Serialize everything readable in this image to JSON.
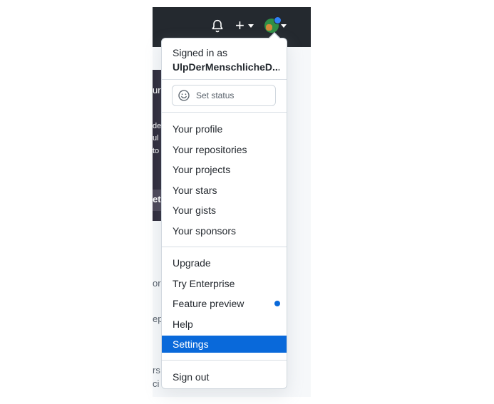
{
  "header": {
    "icons": [
      "bell-icon",
      "plus-icon",
      "avatar"
    ],
    "accent": "#24292f"
  },
  "background": {
    "fragments": [
      "ur",
      "de",
      "ul",
      "to",
      "et",
      "or",
      "ep",
      "rs",
      "ci"
    ]
  },
  "menu": {
    "signed_in_label": "Signed in as",
    "username": "UlpDerMenschlicheD...",
    "set_status": "Set status",
    "profile_items": [
      "Your profile",
      "Your repositories",
      "Your projects",
      "Your stars",
      "Your gists",
      "Your sponsors"
    ],
    "misc_items": [
      "Upgrade",
      "Try Enterprise",
      "Feature preview",
      "Help",
      "Settings"
    ],
    "sign_out": "Sign out",
    "selected": "Settings",
    "selected_color": "#0969da",
    "indicator_color": "#0969da"
  }
}
